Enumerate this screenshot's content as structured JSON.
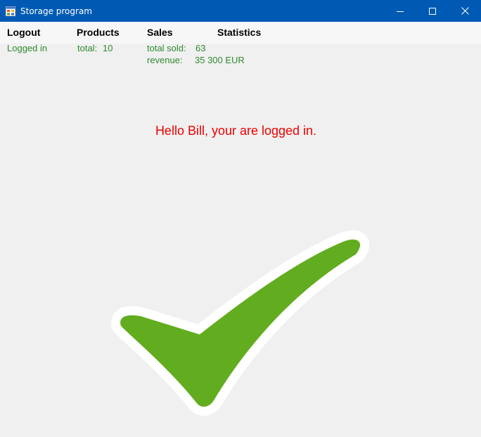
{
  "window": {
    "title": "Storage program",
    "titlebar_color": "#005ab4"
  },
  "menu": {
    "logout": "Logout",
    "products": "Products",
    "sales": "Sales",
    "statistics": "Statistics"
  },
  "status": {
    "color": "#2e8b2e",
    "login_state": "Logged in",
    "products_total_label": "total:",
    "products_total_value": "10",
    "total_sold_label": "total sold:",
    "total_sold_value": "63",
    "revenue_label": "revenue:",
    "revenue_value": "35 300 EUR"
  },
  "main": {
    "greeting": "Hello Bill, your are logged in.",
    "greeting_color": "#ee0000",
    "image_icon": "checkmark-icon",
    "check_color": "#62ad1f"
  }
}
